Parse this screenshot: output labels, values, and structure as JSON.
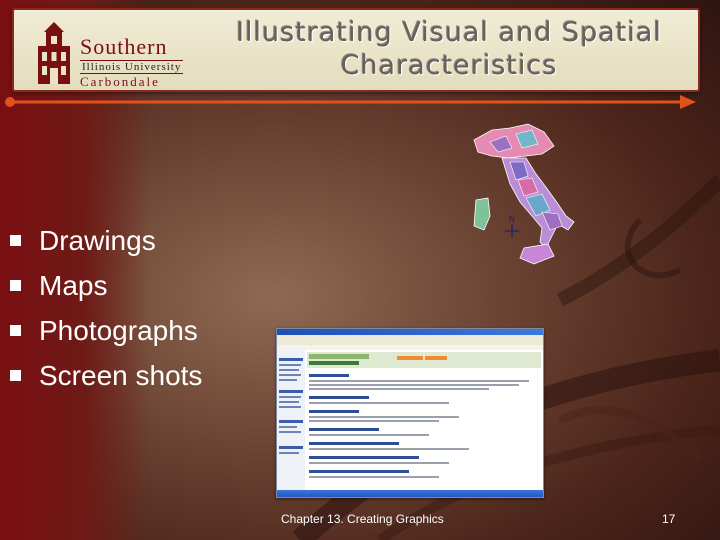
{
  "header": {
    "title_line1": "Illustrating Visual and Spatial",
    "title_line2": "Characteristics",
    "logo": {
      "southern": "Southern",
      "illinois_university": "Illinois University",
      "carbondale": "Carbondale"
    }
  },
  "bullets": [
    "Drawings",
    "Maps",
    "Photographs",
    "Screen shots"
  ],
  "map": {
    "north_label": "N"
  },
  "footer": {
    "text": "Chapter 13. Creating Graphics",
    "page_number": "17"
  },
  "colors": {
    "accent": "#e2501c",
    "crimson": "#7a0f12",
    "title_text": "#66615a",
    "banner": "#e9e3c8"
  }
}
